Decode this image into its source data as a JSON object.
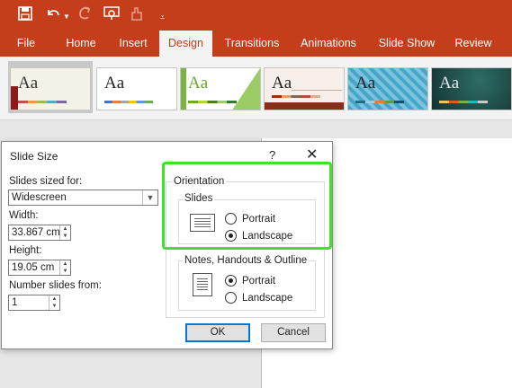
{
  "qat": {
    "save_icon": "save-icon",
    "undo_icon": "undo-icon",
    "redo_icon": "redo-icon",
    "present_icon": "present-from-start-icon",
    "touch_icon": "touch-mode-icon",
    "customize_icon": "customize-qat-icon"
  },
  "tabs": [
    "File",
    "Home",
    "Insert",
    "Design",
    "Transitions",
    "Animations",
    "Slide Show",
    "Review"
  ],
  "active_tab": "Design",
  "themes": [
    {
      "label": "Aa",
      "bg": "#f4f2e6",
      "fg": "#333333"
    },
    {
      "label": "Aa",
      "bg": "#ffffff",
      "fg": "#111111"
    },
    {
      "label": "Aa",
      "bg": "#ffffff",
      "fg": "#6aa82e"
    },
    {
      "label": "Aa",
      "bg": "#f7efe9",
      "fg": "#111111"
    },
    {
      "label": "Aa",
      "bg": "#46a6c9",
      "fg": "#111111"
    },
    {
      "label": "Aa",
      "bg": "#1f4c48",
      "fg": "#e8e8e8"
    }
  ],
  "colors": {
    "brand": "#c43e1c",
    "highlight": "#3ee22a",
    "default_button_border": "#0078d7"
  },
  "dialog": {
    "title": "Slide Size",
    "help": "?",
    "close": "✕",
    "sized_for_label": "Slides sized for:",
    "sized_for_value": "Widescreen",
    "width_label": "Width:",
    "width_value": "33.867 cm",
    "height_label": "Height:",
    "height_value": "19.05 cm",
    "number_from_label": "Number slides from:",
    "number_from_value": "1",
    "orientation_title": "Orientation",
    "slides_group": "Slides",
    "slides_portrait": "Portrait",
    "slides_landscape": "Landscape",
    "notes_group": "Notes, Handouts & Outline",
    "notes_portrait": "Portrait",
    "notes_landscape": "Landscape",
    "ok": "OK",
    "cancel": "Cancel"
  }
}
